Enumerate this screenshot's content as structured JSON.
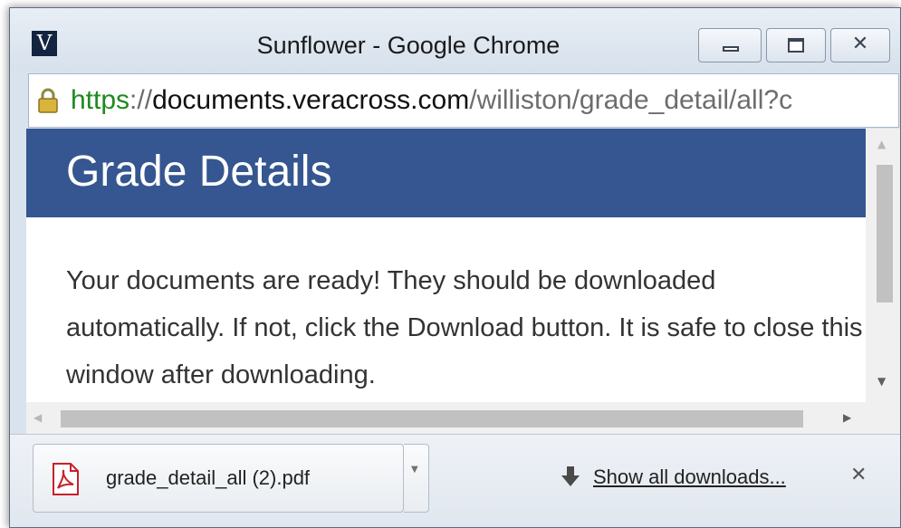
{
  "window": {
    "app_icon_letter": "V",
    "title": "Sunflower - Google Chrome",
    "controls": {
      "minimize_icon": "minimize-icon",
      "maximize_icon": "maximize-icon",
      "close_glyph": "✕"
    }
  },
  "addressbar": {
    "lock_icon": "lock-icon",
    "scheme": "https",
    "separator": "://",
    "host": "documents.veracross.com",
    "path": "/williston/grade_detail/all?c"
  },
  "page": {
    "title": "Grade Details",
    "message": "Your documents are ready! They should be downloaded automatically. If not, click the Download button. It is safe to close this window after downloading."
  },
  "scrollbars": {
    "up_arrow": "▲",
    "down_arrow": "▼",
    "left_arrow": "◀",
    "right_arrow": "▶"
  },
  "downloads": {
    "file_name": "grade_detail_all (2).pdf",
    "dropdown_glyph": "▼",
    "show_all_label": "Show all downloads...",
    "close_glyph": "✕"
  },
  "colors": {
    "header_bg": "#355690",
    "scheme_green": "#1d8a1d",
    "pdf_red": "#c8202a"
  }
}
